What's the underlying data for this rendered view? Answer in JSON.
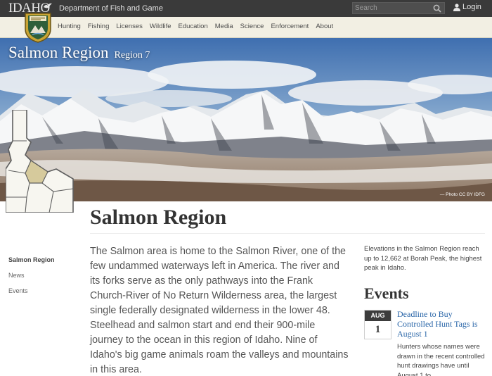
{
  "topbar": {
    "logo_text": "IDAHO",
    "department": "Department of Fish and Game",
    "search_placeholder": "Search",
    "login_label": "Login"
  },
  "nav": {
    "items": [
      "Hunting",
      "Fishing",
      "Licenses",
      "Wildlife",
      "Education",
      "Media",
      "Science",
      "Enforcement",
      "About"
    ]
  },
  "hero": {
    "title": "Salmon Region",
    "subtitle": "Region 7",
    "photo_credit": "— Photo CC BY IDFG"
  },
  "page": {
    "title": "Salmon Region",
    "body": "The Salmon area is home to the Salmon River, one of the few undammed waterways left in America. The river and its forks serve as the only pathways into the Frank Church-River of No Return Wilderness area, the largest single federally designated wilderness in the lower 48. Steelhead and salmon start and end their 900-mile journey to the ocean in this region of Idaho. Nine of Idaho's big game animals roam the valleys and mountains in this area."
  },
  "sidebar": {
    "items": [
      {
        "label": "Salmon Region",
        "active": true
      },
      {
        "label": "News",
        "active": false
      },
      {
        "label": "Events",
        "active": false
      }
    ]
  },
  "aside": {
    "fact": "Elevations in the Salmon Region reach up to 12,662 at Borah Peak, the highest peak in Idaho."
  },
  "events": {
    "heading": "Events",
    "items": [
      {
        "month": "AUG",
        "day": "1",
        "title": "Deadline to Buy Controlled Hunt Tags is August 1",
        "description": "Hunters whose names were drawn in the recent controlled hunt drawings have until August 1 to"
      }
    ]
  },
  "colors": {
    "topbar_bg": "#3a3a3a",
    "navbar_bg": "#f2efe3",
    "link_blue": "#2a66a8",
    "region_highlight": "#d6ca9c",
    "map_fill": "#f7f6f0"
  }
}
